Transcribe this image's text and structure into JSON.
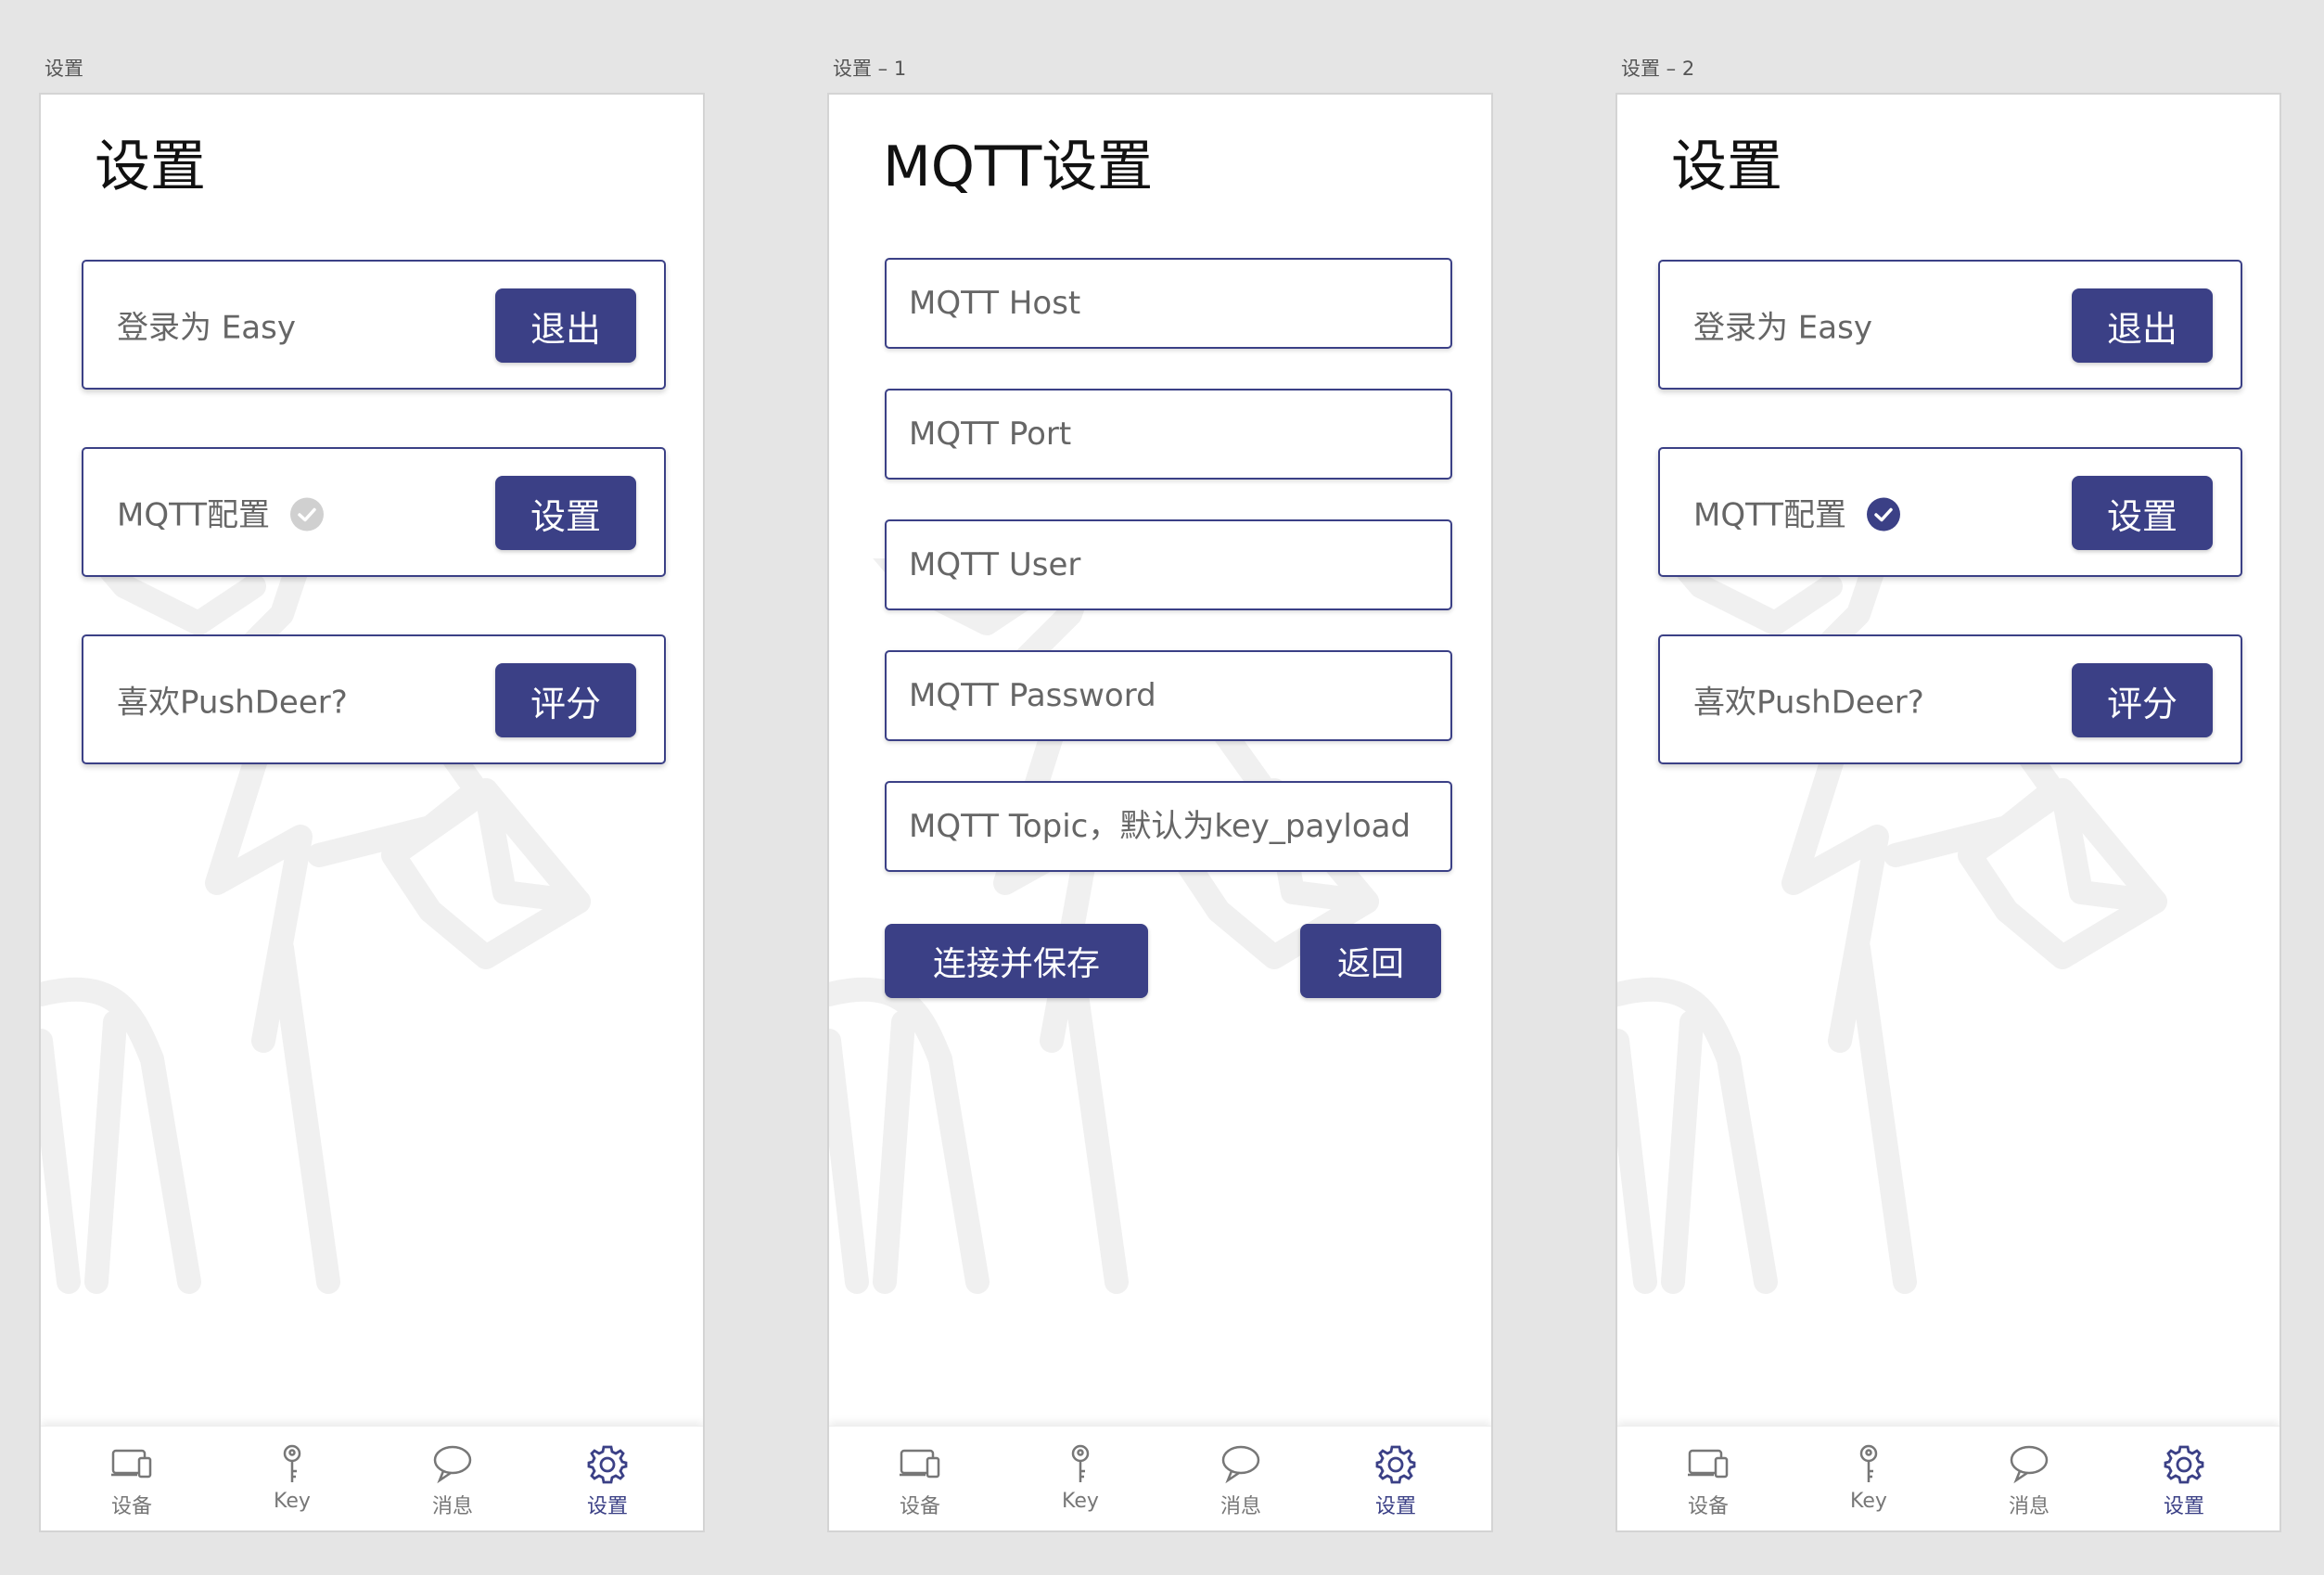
{
  "colors": {
    "accent": "#3b4086",
    "inactive_check": "#d0d0d0",
    "canvas": "#e5e5e5"
  },
  "artboards": [
    {
      "label": "设置"
    },
    {
      "label": "设置 – 1"
    },
    {
      "label": "设置 – 2"
    }
  ],
  "settings": {
    "title": "设置",
    "login_label": "登录为 Easy",
    "logout_button": "退出",
    "mqtt_label": "MQTT配置",
    "mqtt_button": "设置",
    "like_label": "喜欢PushDeer?",
    "rate_button": "评分"
  },
  "mqtt": {
    "title": "MQTT设置",
    "host_placeholder": "MQTT Host",
    "port_placeholder": "MQTT Port",
    "user_placeholder": "MQTT User",
    "password_placeholder": "MQTT Password",
    "topic_placeholder": "MQTT Topic，默认为key_payload",
    "save_button": "连接并保存",
    "back_button": "返回"
  },
  "mqtt_configured": [
    false,
    true
  ],
  "tabs": [
    {
      "label": "设备",
      "icon": "devices-icon"
    },
    {
      "label": "Key",
      "icon": "key-icon"
    },
    {
      "label": "消息",
      "icon": "message-bubble-icon"
    },
    {
      "label": "设置",
      "icon": "gear-icon"
    }
  ],
  "active_tab": "设置"
}
